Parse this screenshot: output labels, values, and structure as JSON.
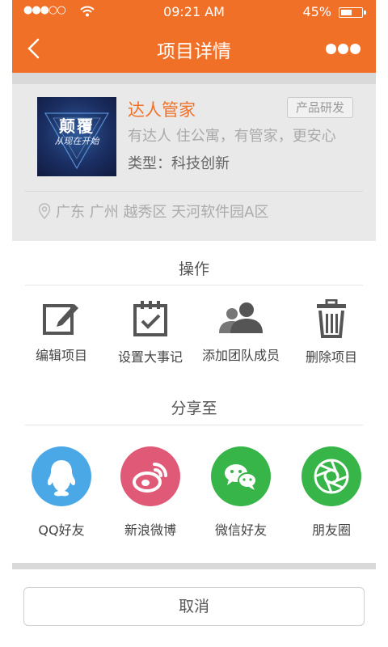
{
  "status_bar": {
    "signal": "●●●○○",
    "time": "09:21 AM",
    "battery": "45%",
    "battery_level": 0.45
  },
  "nav": {
    "title": "项目详情"
  },
  "project": {
    "name": "达人管家",
    "tag": "产品研发",
    "slogan": "有达人 住公寓，有管家，更安心",
    "type": "类型：科技创新",
    "location": "广东 广州 越秀区 天河软件园A区",
    "thumb_title": "颠覆",
    "thumb_subtitle": "从现在开始"
  },
  "operations": {
    "title": "操作",
    "items": [
      {
        "label": "编辑项目",
        "icon": "edit-icon"
      },
      {
        "label": "设置大事记",
        "icon": "calendar-check-icon"
      },
      {
        "label": "添加团队成员",
        "icon": "team-icon"
      },
      {
        "label": "删除项目",
        "icon": "trash-icon"
      }
    ]
  },
  "share": {
    "title": "分享至",
    "items": [
      {
        "label": "QQ好友",
        "icon": "qq-icon",
        "color": "#4aa8e6"
      },
      {
        "label": "新浪微博",
        "icon": "weibo-icon",
        "color": "#e05a78"
      },
      {
        "label": "微信好友",
        "icon": "wechat-icon",
        "color": "#38b549"
      },
      {
        "label": "朋友圈",
        "icon": "moments-icon",
        "color": "#38b549"
      }
    ]
  },
  "cancel_label": "取消",
  "colors": {
    "accent": "#f07028"
  }
}
